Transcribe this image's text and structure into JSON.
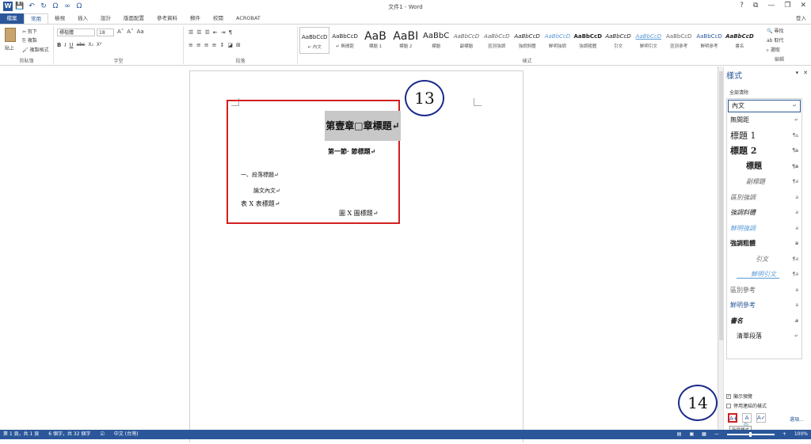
{
  "window": {
    "title": "文件1 - Word",
    "controls": [
      "?",
      "⧉",
      "—",
      "❐",
      "✕"
    ],
    "signin": "登入"
  },
  "qat": {
    "logo": "W",
    "save": "💾",
    "undo": "↶",
    "redo": "↻",
    "omega1": "Ω",
    "infinity": "∞",
    "omega2": "Ω"
  },
  "ribbon_tabs": [
    "檔案",
    "常用",
    "檢視",
    "插入",
    "設計",
    "版面配置",
    "參考資料",
    "郵件",
    "校閱",
    "ACROBAT"
  ],
  "clipboard": {
    "paste": "貼上",
    "cut": "✂ 剪下",
    "copy": "⎘ 複製",
    "format_painter": "🖌 複製格式",
    "label": "剪貼簿"
  },
  "font_group": {
    "font_name": "標楷體",
    "font_size": "18",
    "bold": "B",
    "italic": "I",
    "underline": "U",
    "strike": "abc",
    "sub": "X₂",
    "sup": "X²",
    "grow": "A˄",
    "shrink": "A˅",
    "case": "Aa",
    "label": "字型"
  },
  "paragraph_group": {
    "label": "段落"
  },
  "styles_group": {
    "label": "樣式",
    "items": [
      {
        "preview": "AaBbCcD",
        "name": "↵ 內文"
      },
      {
        "preview": "AaBbCcD",
        "name": "↵ 無間距"
      },
      {
        "preview": "AaB",
        "name": "標題 1"
      },
      {
        "preview": "AaBI",
        "name": "標題 2"
      },
      {
        "preview": "AaBbC",
        "name": "標題"
      },
      {
        "preview": "AaBbCcD",
        "name": "副標題"
      },
      {
        "preview": "AaBbCcD",
        "name": "區別強調"
      },
      {
        "preview": "AaBbCcD",
        "name": "強調斜體"
      },
      {
        "preview": "AaBbCcD",
        "name": "鮮明強調"
      },
      {
        "preview": "AaBbCcD",
        "name": "強調粗體"
      },
      {
        "preview": "AaBbCcD",
        "name": "引文"
      },
      {
        "preview": "AaBbCcD",
        "name": "鮮明引文"
      },
      {
        "preview": "AaBbCcD",
        "name": "區別參考"
      },
      {
        "preview": "AaBbCcD",
        "name": "鮮明參考"
      },
      {
        "preview": "AaBbCcD",
        "name": "書名"
      }
    ]
  },
  "editing_group": {
    "find": "🔍 尋找",
    "replace": "ab 取代",
    "select": "▹ 選取",
    "label": "編輯"
  },
  "document": {
    "chapter_heading": "第壹章□章標題↵",
    "section_heading": "第一節· 節標題↵",
    "paragraph_heading": "一、段落標題↵",
    "body_text": "論文內文↵",
    "table_caption": "表 X 表標題↵",
    "figure_caption": "圖 X 圖標題↵"
  },
  "callouts": {
    "top": "13",
    "bottom": "14"
  },
  "styles_pane": {
    "title": "樣式",
    "controls": [
      "▾",
      "✕"
    ],
    "clear_all": "全部清除",
    "items": [
      {
        "name": "內文",
        "kind": "↵"
      },
      {
        "name": "無間距",
        "kind": "↵"
      },
      {
        "name": "標題 1",
        "kind": "¶a"
      },
      {
        "name": "標題 2",
        "kind": "¶a"
      },
      {
        "name": "標題",
        "kind": "¶a"
      },
      {
        "name": "副標題",
        "kind": "¶a"
      },
      {
        "name": "區別強調",
        "kind": "a"
      },
      {
        "name": "強調斜體",
        "kind": "a"
      },
      {
        "name": "鮮明強調",
        "kind": "a"
      },
      {
        "name": "強調粗體",
        "kind": "a"
      },
      {
        "name": "引文",
        "kind": "¶a"
      },
      {
        "name": "鮮明引文",
        "kind": "¶a"
      },
      {
        "name": "區別參考",
        "kind": "a"
      },
      {
        "name": "鮮明參考",
        "kind": "a"
      },
      {
        "name": "書名",
        "kind": "a"
      },
      {
        "name": "清單段落",
        "kind": "↵"
      }
    ],
    "show_preview": "顯示預覽",
    "disable_linked": "停用連結的樣式",
    "new_style_btn": "A+",
    "inspector_btn": "A🔍",
    "manage_btn": "A✓",
    "options": "選項...",
    "tooltip": "新增樣式"
  },
  "statusbar": {
    "page": "第 1 頁，共 1 頁",
    "words": "6 個字，共 32 個字",
    "proof": "☑",
    "language": "中文 (台灣)",
    "zoom_minus": "—",
    "zoom_plus": "+",
    "zoom": "100%"
  },
  "colors": {
    "accent": "#2b579a",
    "callout_border": "#1a2a8a",
    "highlight_border": "#d21f1f"
  }
}
